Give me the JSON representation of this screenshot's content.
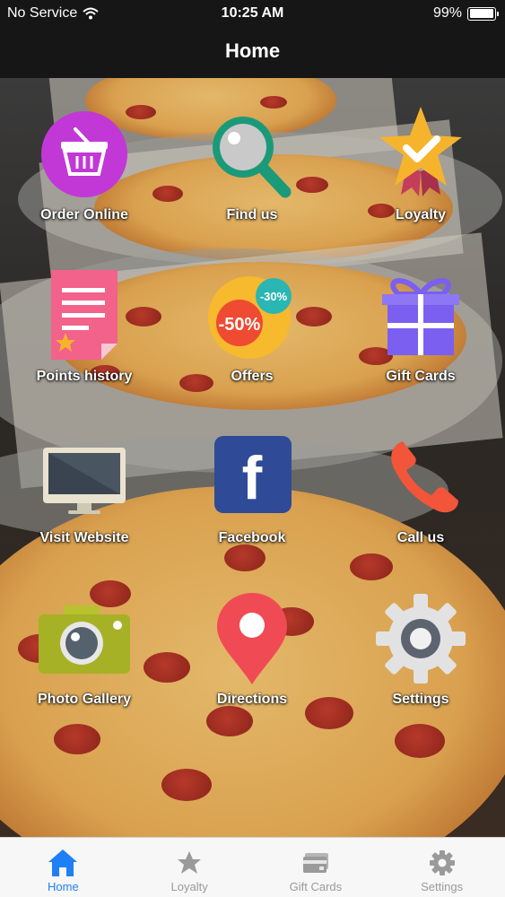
{
  "status_bar": {
    "carrier": "No Service",
    "time": "10:25 AM",
    "battery_percent": "99%",
    "battery_level": 0.99
  },
  "nav": {
    "title": "Home"
  },
  "tiles": [
    {
      "label": "Order Online",
      "icon": "basket-icon"
    },
    {
      "label": "Find us",
      "icon": "magnifier-icon"
    },
    {
      "label": "Loyalty",
      "icon": "star-badge-icon"
    },
    {
      "label": "Points history",
      "icon": "document-icon"
    },
    {
      "label": "Offers",
      "icon": "discount-icon",
      "badge_big": "-50%",
      "badge_small": "-30%"
    },
    {
      "label": "Gift Cards",
      "icon": "gift-icon"
    },
    {
      "label": "Visit Website",
      "icon": "monitor-icon"
    },
    {
      "label": "Facebook",
      "icon": "facebook-icon",
      "glyph": "f"
    },
    {
      "label": "Call us",
      "icon": "phone-icon"
    },
    {
      "label": "Photo Gallery",
      "icon": "camera-icon"
    },
    {
      "label": "Directions",
      "icon": "map-pin-icon"
    },
    {
      "label": "Settings",
      "icon": "gear-icon"
    }
  ],
  "tab_bar": {
    "active": "Home",
    "tabs": [
      {
        "label": "Home",
        "icon": "home-icon"
      },
      {
        "label": "Loyalty",
        "icon": "star-icon"
      },
      {
        "label": "Gift Cards",
        "icon": "cards-icon"
      },
      {
        "label": "Settings",
        "icon": "gear-icon"
      }
    ]
  },
  "colors": {
    "accent": "#1f7ff5",
    "nav_bg": "#161616",
    "tab_bg": "#f7f7f7",
    "tab_inactive": "#9a9a9a"
  }
}
